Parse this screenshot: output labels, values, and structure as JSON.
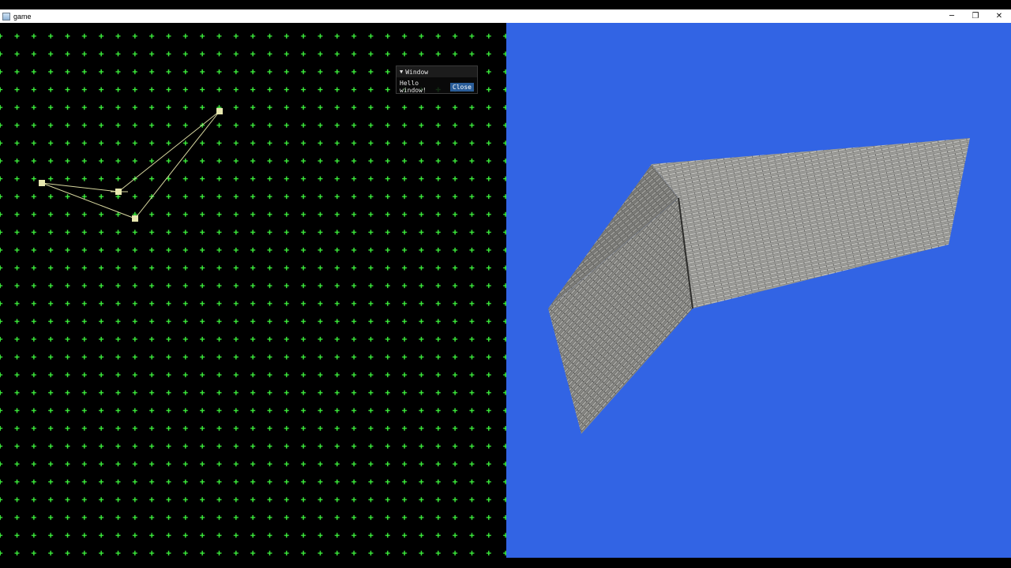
{
  "window": {
    "title": "game",
    "controls": {
      "minimize_glyph": "─",
      "restore_glyph": "❐",
      "close_glyph": "✕"
    }
  },
  "editor": {
    "grid_color": "#3cf03c",
    "marker_color": "#e8e8b0",
    "line_color": "#d8d8a0"
  },
  "imgui": {
    "title": "Window",
    "collapse_glyph": "▼",
    "body_text": "Hello window!",
    "close_label": "Close"
  },
  "viewport": {
    "background": "#3264e4",
    "wall_color": "#7a7a78"
  }
}
